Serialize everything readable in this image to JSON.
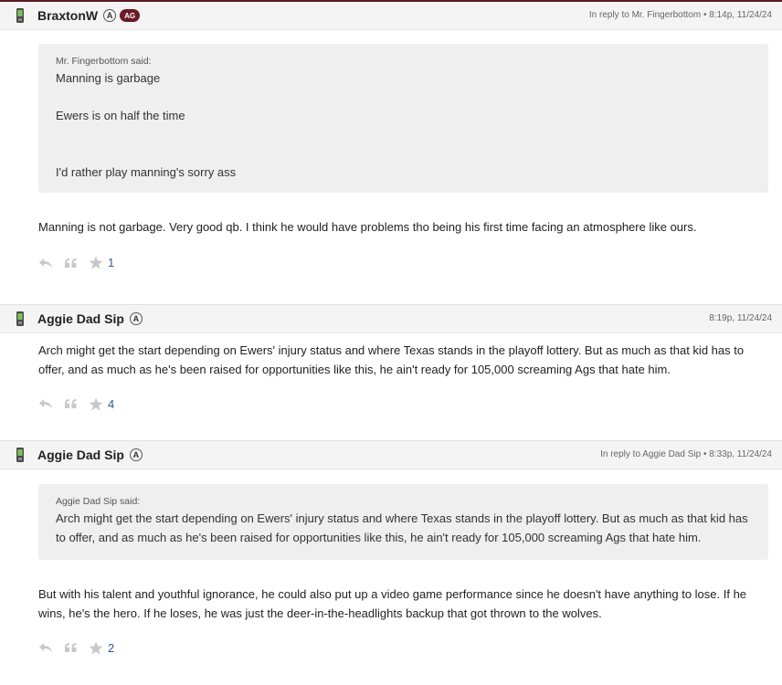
{
  "posts": [
    {
      "author": "BraxtonW",
      "badges": [
        "A",
        "AG"
      ],
      "meta_prefix": "In reply to ",
      "meta_reply_to": "Mr. Fingerbottom",
      "meta_time": " • 8:14p, 11/24/24",
      "quote": {
        "attribution": "Mr. Fingerbottom said:",
        "lines": [
          "Manning is garbage",
          "",
          "Ewers is on half the time",
          "",
          "",
          "I'd rather play manning's sorry ass"
        ]
      },
      "body": "Manning is not garbage. Very good qb. I think he would have problems tho being his first time facing an atmosphere like ours.",
      "likes": "1"
    },
    {
      "author": "Aggie Dad Sip",
      "badges": [
        "A"
      ],
      "meta_time": "8:19p, 11/24/24",
      "body": "Arch might get the start depending on Ewers' injury status and where Texas stands in the playoff lottery. But as much as that kid has to offer, and as much as he's been raised for opportunities like this, he ain't ready for 105,000 screaming Ags that hate him.",
      "likes": "4"
    },
    {
      "author": "Aggie Dad Sip",
      "badges": [
        "A"
      ],
      "meta_prefix": "In reply to ",
      "meta_reply_to": "Aggie Dad Sip",
      "meta_time": " • 8:33p, 11/24/24",
      "quote": {
        "attribution": "Aggie Dad Sip said:",
        "text": "Arch might get the start depending on Ewers' injury status and where Texas stands in the playoff lottery. But as much as that kid has to offer, and as much as he's been raised for opportunities like this, he ain't ready for 105,000 screaming Ags that hate him."
      },
      "body": "But with his talent and youthful ignorance, he could also put up a video game performance since he doesn't have anything to lose. If he wins, he's the hero. If he loses, he was just the deer-in-the-headlights backup that got thrown to the wolves.",
      "likes": "2"
    }
  ],
  "icons": {
    "device": "mobile-phone-icon",
    "reply": "reply-arrow-icon",
    "quote": "quote-icon",
    "like": "star-icon"
  },
  "colors": {
    "accent": "#5a1a24",
    "badge_ag": "#6b1a26",
    "like_count": "#2e5c9a"
  }
}
